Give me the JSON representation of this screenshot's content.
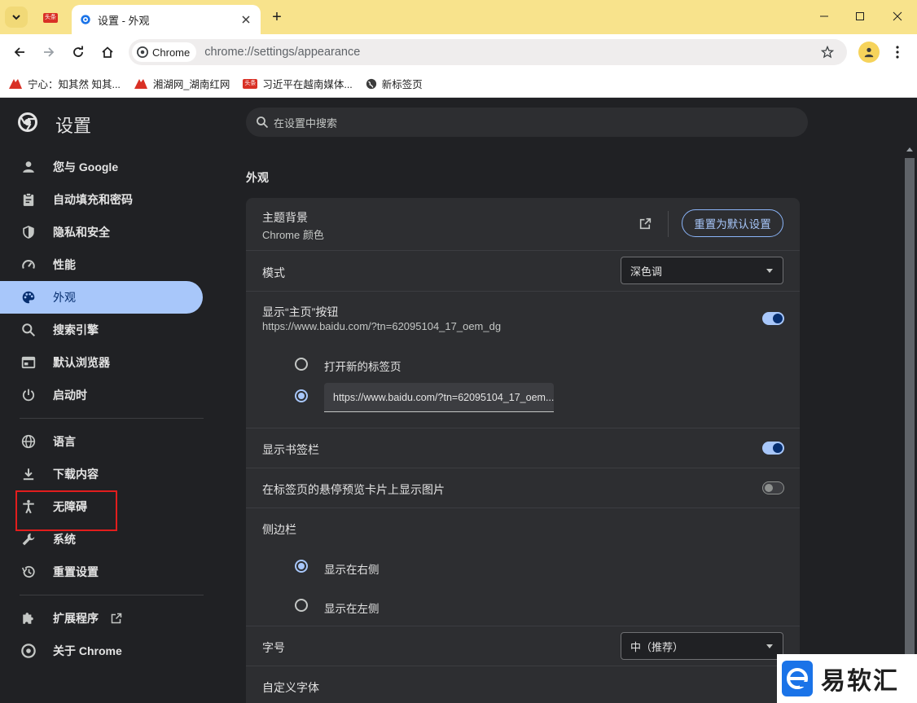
{
  "browser": {
    "pinned_tab_badge": "头条",
    "active_tab_title": "设置 - 外观",
    "new_tab_label": "+",
    "chip_label": "Chrome",
    "url": "chrome://settings/appearance"
  },
  "bookmarks": [
    {
      "label": "宁心：知其然 知其..."
    },
    {
      "label": "湘湖网_湖南红网"
    },
    {
      "label": "习近平在越南媒体..."
    },
    {
      "label": "新标签页"
    }
  ],
  "header": {
    "title": "设置",
    "search_placeholder": "在设置中搜索"
  },
  "sidebar": {
    "items": [
      {
        "label": "您与 Google",
        "icon": "person-icon"
      },
      {
        "label": "自动填充和密码",
        "icon": "clipboard-icon"
      },
      {
        "label": "隐私和安全",
        "icon": "shield-icon"
      },
      {
        "label": "性能",
        "icon": "speedometer-icon"
      },
      {
        "label": "外观",
        "icon": "palette-icon"
      },
      {
        "label": "搜索引擎",
        "icon": "search-icon"
      },
      {
        "label": "默认浏览器",
        "icon": "browser-icon"
      },
      {
        "label": "启动时",
        "icon": "power-icon"
      },
      {
        "label": "语言",
        "icon": "globe-icon"
      },
      {
        "label": "下载内容",
        "icon": "download-icon"
      },
      {
        "label": "无障碍",
        "icon": "accessibility-icon"
      },
      {
        "label": "系统",
        "icon": "wrench-icon"
      },
      {
        "label": "重置设置",
        "icon": "history-icon"
      },
      {
        "label": "扩展程序",
        "icon": "puzzle-icon"
      },
      {
        "label": "关于 Chrome",
        "icon": "chrome-icon"
      }
    ]
  },
  "appearance": {
    "section_title": "外观",
    "theme_label": "主题背景",
    "theme_value": "Chrome 颜色",
    "reset_button": "重置为默认设置",
    "mode_label": "模式",
    "mode_value": "深色调",
    "home_label": "显示“主页”按钮",
    "home_url": "https://www.baidu.com/?tn=62095104_17_oem_dg",
    "home_option_newtab": "打开新的标签页",
    "home_option_url": "https://www.baidu.com/?tn=62095104_17_oem...",
    "bookmarks_bar_label": "显示书签栏",
    "hover_preview_label": "在标签页的悬停预览卡片上显示图片",
    "side_panel_label": "侧边栏",
    "side_right": "显示在右侧",
    "side_left": "显示在左侧",
    "font_size_label": "字号",
    "font_size_value": "中（推荐）",
    "custom_fonts_label": "自定义字体"
  },
  "watermark": {
    "text": "易软汇"
  },
  "colors": {
    "accent": "#a8c7fa",
    "page_bg": "#202124",
    "card_bg": "#2d2e31",
    "title_bar": "#f8e38c",
    "highlight_box": "#e21d1d"
  }
}
